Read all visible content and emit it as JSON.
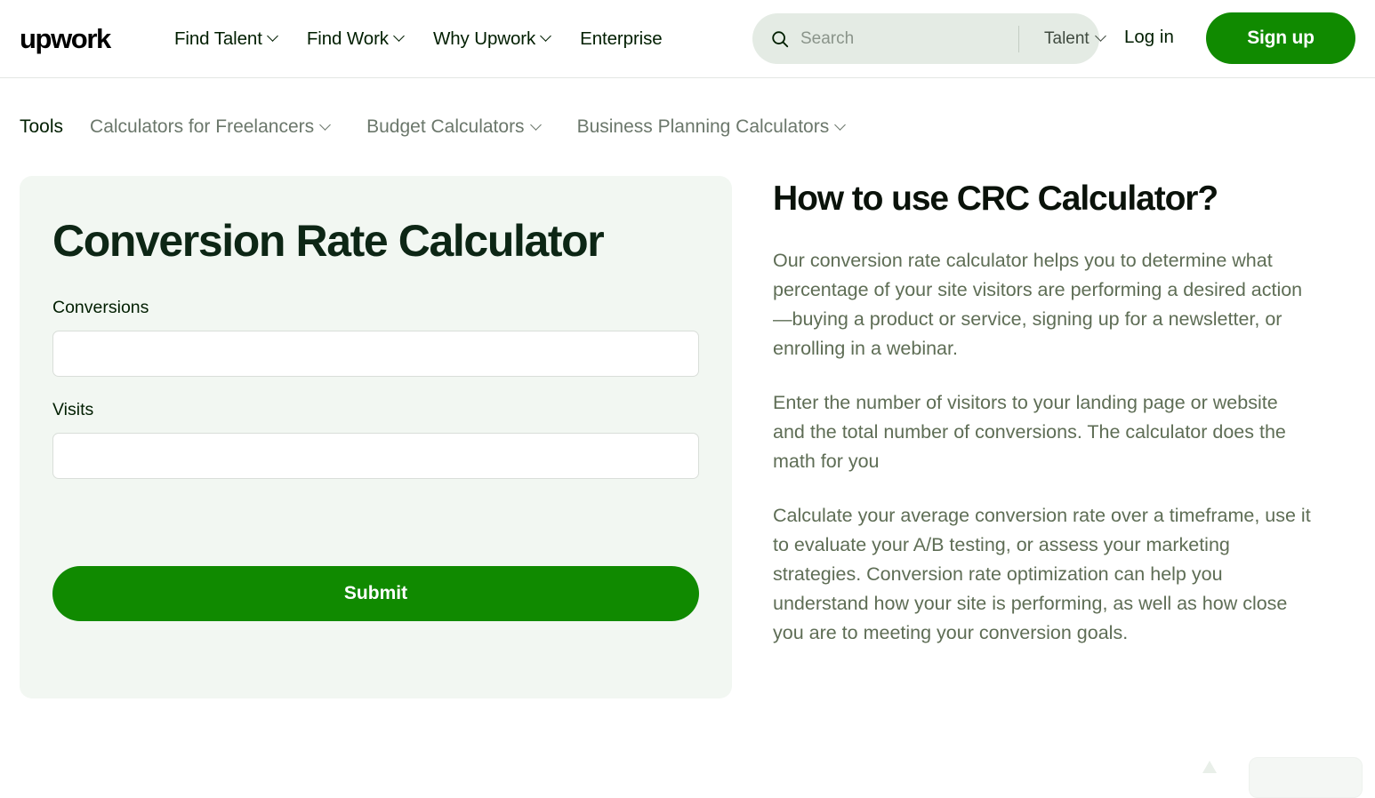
{
  "header": {
    "logo_alt": "upwork",
    "nav": [
      {
        "label": "Find Talent",
        "has_chevron": true
      },
      {
        "label": "Find Work",
        "has_chevron": true
      },
      {
        "label": "Why Upwork",
        "has_chevron": true
      },
      {
        "label": "Enterprise",
        "has_chevron": false
      }
    ],
    "search": {
      "placeholder": "Search",
      "value": "",
      "scope_label": "Talent"
    },
    "login_label": "Log in",
    "signup_label": "Sign up"
  },
  "subnav": {
    "title": "Tools",
    "items": [
      {
        "label": "Calculators for Freelancers"
      },
      {
        "label": "Budget Calculators"
      },
      {
        "label": "Business Planning Calculators"
      }
    ]
  },
  "calculator": {
    "title": "Conversion Rate Calculator",
    "fields": [
      {
        "label": "Conversions",
        "value": "",
        "placeholder": ""
      },
      {
        "label": "Visits",
        "value": "",
        "placeholder": ""
      }
    ],
    "submit_label": "Submit"
  },
  "info": {
    "title": "How to use CRC Calculator?",
    "paragraphs": [
      "Our conversion rate calculator helps you to determine what percentage of your site visitors are performing a desired action—buying a product or service, signing up for a newsletter, or enrolling in a webinar.",
      "Enter the number of visitors to your landing page or website and the total number of conversions. The calculator does the math for you",
      "Calculate your average conversion rate over a timeframe, use it to evaluate your A/B testing, or assess your marketing strategies. Conversion rate optimization can help you understand how your site is performing, as well as how close you are to meeting your conversion goals."
    ]
  },
  "colors": {
    "brand_green": "#108a00",
    "card_background": "#f2f7f2",
    "title_green": "#0d2615",
    "body_text": "#5e6d55",
    "search_background": "#e4ebe4"
  }
}
